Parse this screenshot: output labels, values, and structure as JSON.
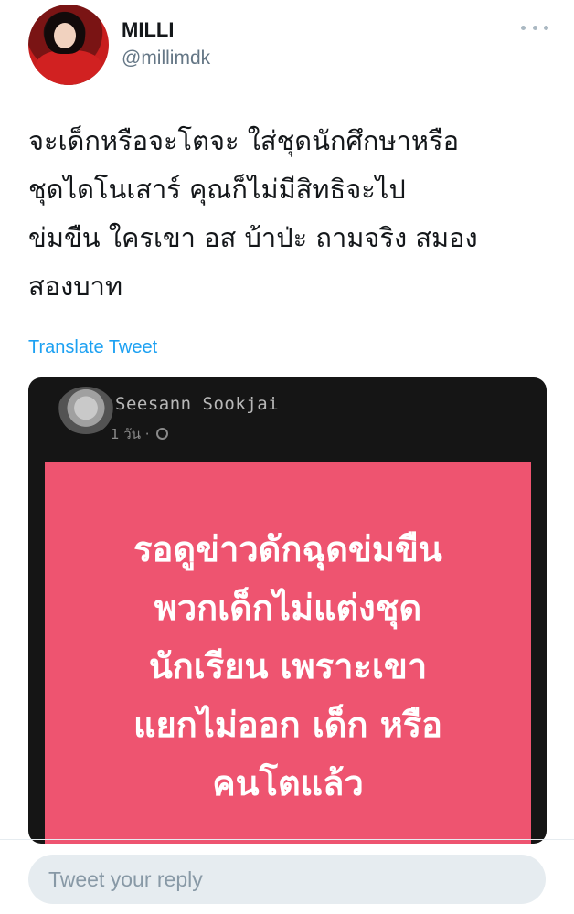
{
  "tweet": {
    "author": {
      "display_name": "MILLI",
      "handle": "@millimdk"
    },
    "text_lines": [
      "จะเด็กหรือจะโตจะ ใส่ชุดนักศึกษาหรือ",
      "ชุดไดโนเสาร์ คุณก็ไม่มีสิทธิจะไป",
      "ข่มขืน ใครเขา อส บ้าป่ะ ถามจริง สมอง",
      "สองบาท"
    ],
    "translate_label": "Translate Tweet"
  },
  "media": {
    "fb_post": {
      "author_name": "Seesann Sookjai",
      "time_label": "1 วัน ·",
      "card_lines": [
        "รอดูข่าวดักฉุดข่มขืน",
        "พวกเด็กไม่แต่งชุด",
        "นักเรียน  เพราะเขา",
        "แยกไม่ออก เด็ก หรือ",
        "คนโตแล้ว"
      ],
      "card_color": "#ee5470"
    }
  },
  "reply": {
    "placeholder": "Tweet your reply"
  },
  "colors": {
    "link": "#1da1f2",
    "secondary_text": "#657786",
    "reply_box_bg": "#e6ecf0"
  }
}
